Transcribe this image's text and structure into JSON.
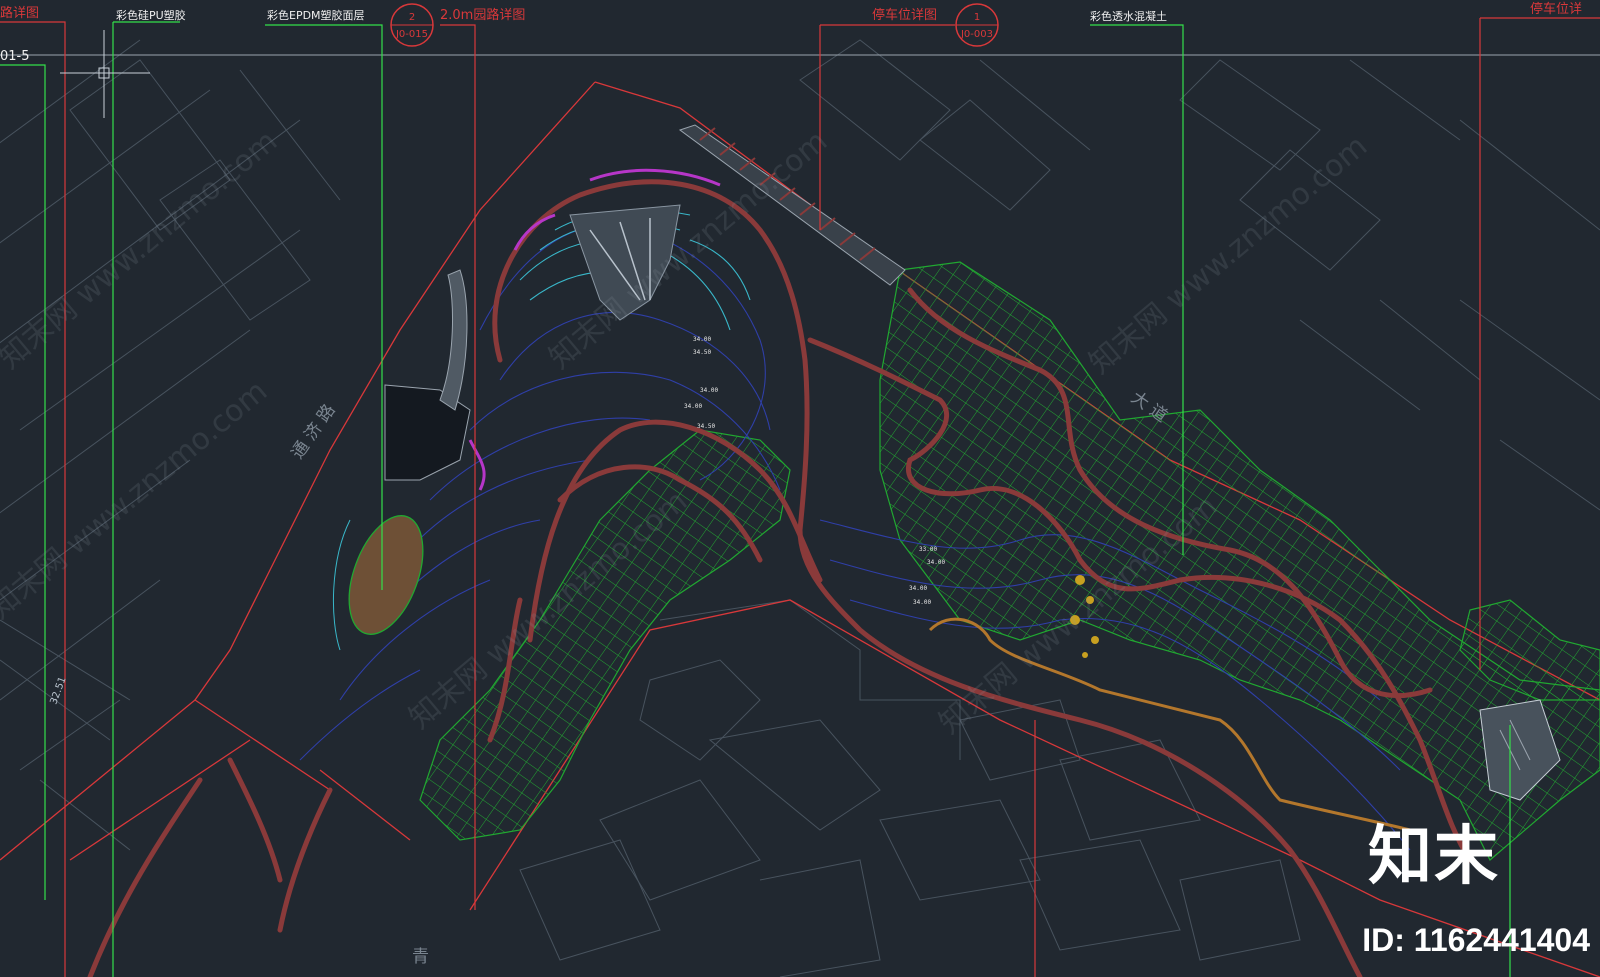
{
  "labels": {
    "detail_left": "路详图",
    "pu": "彩色硅PU塑胶",
    "epdm": "彩色EPDM塑胶面层",
    "path_detail": "2.0m园路详图",
    "path_tag_num": "2",
    "path_tag_ref": "J0-015",
    "parking": "停车位详图",
    "parking_tag_num": "1",
    "parking_tag_ref": "J0-003",
    "concrete": "彩色透水混凝土",
    "parking_right": "停车位详",
    "left_ref": "01-5",
    "elevation": "32.51"
  },
  "roads": {
    "tongji": "通 济 路",
    "bottom": "青",
    "right": "大 道"
  },
  "contour_labels": [
    "34.00",
    "34.50",
    "34.00",
    "34.00",
    "34.50",
    "33.00",
    "34.00",
    "34.00",
    "34.00"
  ],
  "watermark": {
    "site": "知末网 www.znzmo.com"
  },
  "brand": {
    "logo": "知末",
    "id": "ID: 1162441404"
  },
  "colors": {
    "background": "#212830",
    "leader_red": "#d8383a",
    "leader_green": "#34e04a",
    "hatch_green": "#1f9e2c",
    "path_brown": "#8a3a3a",
    "contour_blue": "#2f3fa8",
    "contour_cyan": "#39b7c9",
    "magenta": "#b636c8",
    "building_gray": "#4a5560"
  }
}
